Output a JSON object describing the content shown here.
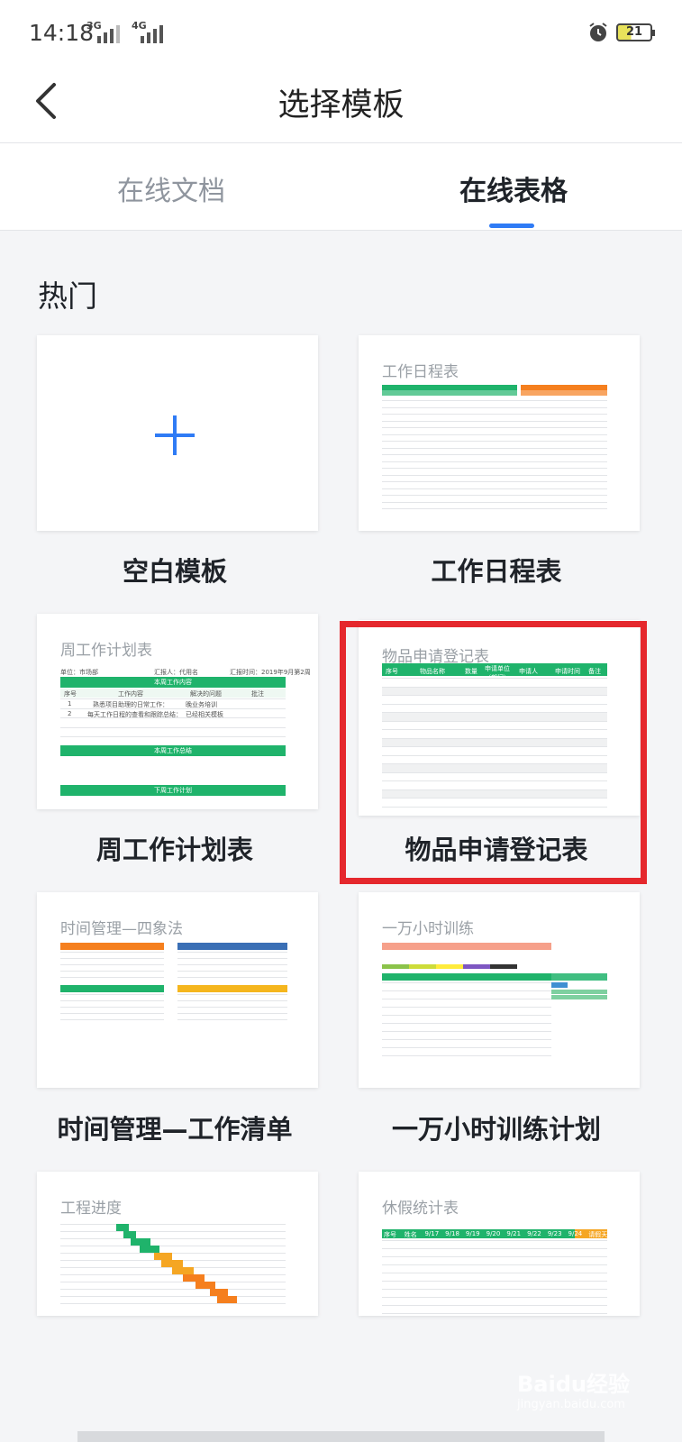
{
  "status": {
    "time": "14:18",
    "net1": "3G",
    "net2": "4G",
    "battery": "21"
  },
  "header": {
    "title": "选择模板"
  },
  "tabs": [
    {
      "label": "在线文档"
    },
    {
      "label": "在线表格"
    }
  ],
  "section": {
    "title": "热门"
  },
  "templates": [
    {
      "name": "空白模板",
      "thumb_title": ""
    },
    {
      "name": "工作日程表",
      "thumb_title": "工作日程表"
    },
    {
      "name": "周工作计划表",
      "thumb_title": "周工作计划表",
      "doc": {
        "unit": "单位：市场部",
        "reporter": "汇报人：代用名",
        "date": "汇报时间：2019年9月第2周",
        "section1": "本周工作内容",
        "section2": "本周工作总结",
        "section3": "下周工作计划",
        "cols": [
          "序号",
          "工作内容",
          "解决的问题",
          "批注"
        ],
        "rows": [
          [
            "1",
            "熟悉项目助理的日常工作：",
            "晚业务培训",
            ""
          ],
          [
            "2",
            "每天工作日程的查看和跟踪总结：",
            "已经相关模板",
            ""
          ]
        ]
      }
    },
    {
      "name": "物品申请登记表",
      "thumb_title": "物品申请登记表",
      "doc": {
        "cols": [
          "序号",
          "物品名称",
          "数量",
          "申请单位（部门）",
          "申请人",
          "申请时间",
          "备注"
        ]
      }
    },
    {
      "name": "时间管理—工作清单",
      "thumb_title": "时间管理—四象法"
    },
    {
      "name": "一万小时训练计划",
      "thumb_title": "一万小时训练"
    },
    {
      "name": "",
      "thumb_title": "工程进度"
    },
    {
      "name": "",
      "thumb_title": "休假统计表",
      "doc": {
        "cols": [
          "序号",
          "姓名",
          "9/17",
          "9/18",
          "9/19",
          "9/20",
          "9/21",
          "9/22",
          "9/23",
          "9/24",
          "请假天数"
        ]
      }
    }
  ],
  "watermark": {
    "brand": "Baidu经验",
    "url": "jingyan.baidu.com"
  },
  "colors": {
    "accent": "#2f7bf5",
    "green": "#1fb36b",
    "highlight": "#e5282d",
    "orange": "#f57f1e"
  }
}
